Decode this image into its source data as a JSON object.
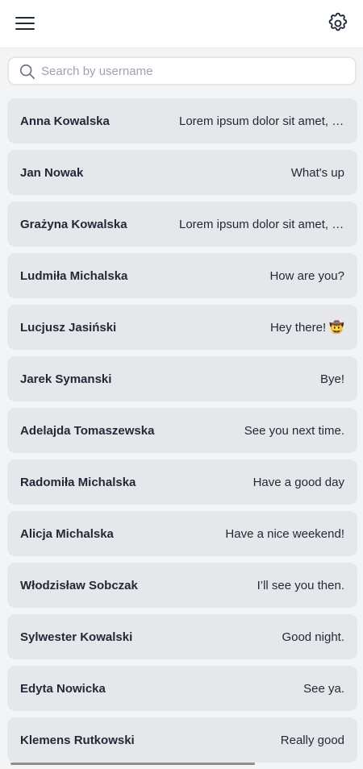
{
  "header": {
    "menu_icon": "hamburger-menu-icon",
    "settings_icon": "gear-icon"
  },
  "search": {
    "placeholder": "Search by username",
    "value": "",
    "icon": "search-icon"
  },
  "chats": [
    {
      "name": "Anna Kowalska",
      "message": "Lorem ipsum dolor sit amet, consectetur"
    },
    {
      "name": "Jan Nowak",
      "message": "What's up"
    },
    {
      "name": "Grażyna Kowalska",
      "message": "Lorem ipsum dolor sit amet, consectetur"
    },
    {
      "name": "Ludmiła Michalska",
      "message": "How are you?"
    },
    {
      "name": "Lucjusz Jasiński",
      "message": "Hey there! 🤠"
    },
    {
      "name": "Jarek Symanski",
      "message": "Bye!"
    },
    {
      "name": "Adelajda Tomaszewska",
      "message": "See you next time."
    },
    {
      "name": "Radomiła Michalska",
      "message": "Have a good day"
    },
    {
      "name": "Alicja Michalska",
      "message": "Have a nice weekend!"
    },
    {
      "name": "Włodzisław Sobczak",
      "message": "I’ll see you then."
    },
    {
      "name": "Sylwester Kowalski",
      "message": "Good night."
    },
    {
      "name": "Edyta Nowicka",
      "message": "See ya."
    },
    {
      "name": "Klemens Rutkowski",
      "message": "Really good"
    }
  ],
  "colors": {
    "background": "#f3f4f6",
    "header": "#ffffff",
    "item": "#e5e7eb",
    "text": "#1f2937",
    "placeholder": "#9ca3af"
  }
}
